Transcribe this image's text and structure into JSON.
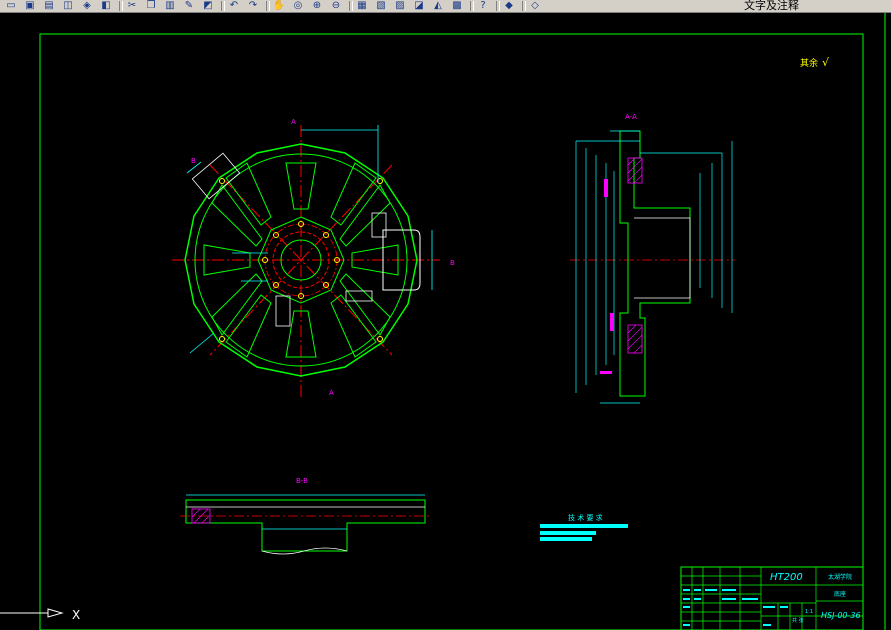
{
  "toolbar": {
    "layer_control_label": "文字及注释",
    "icons": [
      "open-icon",
      "save-icon",
      "print-icon",
      "preview-icon",
      "publish-icon",
      "plot-icon",
      "cut-icon",
      "copy-icon",
      "paste-icon",
      "match-properties-icon",
      "block-editor-icon",
      "undo-icon",
      "redo-icon",
      "pan-icon",
      "zoom-realtime-icon",
      "zoom-window-icon",
      "zoom-previous-icon",
      "properties-icon",
      "design-center-icon",
      "tool-palette-icon",
      "sheet-set-icon",
      "markup-icon",
      "calculator-icon",
      "help-icon",
      "layer-manager-icon",
      "layer-state-icon"
    ]
  },
  "drawing": {
    "roughness_note": "其余",
    "roughness_symbol": "√",
    "section_a_label": "A-A",
    "section_b_label": "B-B",
    "cut_a_top": "A",
    "cut_a_bottom": "A",
    "cut_b_left": "B",
    "cut_b_right": "B",
    "tech_requirements_title": "技 术 要 求",
    "title_block": {
      "material": "HT200",
      "school": "太湖学院",
      "part_name": "底座",
      "drawing_number": "HSJ-00-36",
      "scale": "1:1",
      "sheet": "共 张"
    },
    "ucs_axis_label": "X"
  },
  "colors": {
    "background": "#000000",
    "outline": "#00ff00",
    "centerline": "#ff0000",
    "dimension": "#00ffff",
    "hatch": "#ff00ff",
    "detail": "#ffffff",
    "text": "#ffff00"
  }
}
